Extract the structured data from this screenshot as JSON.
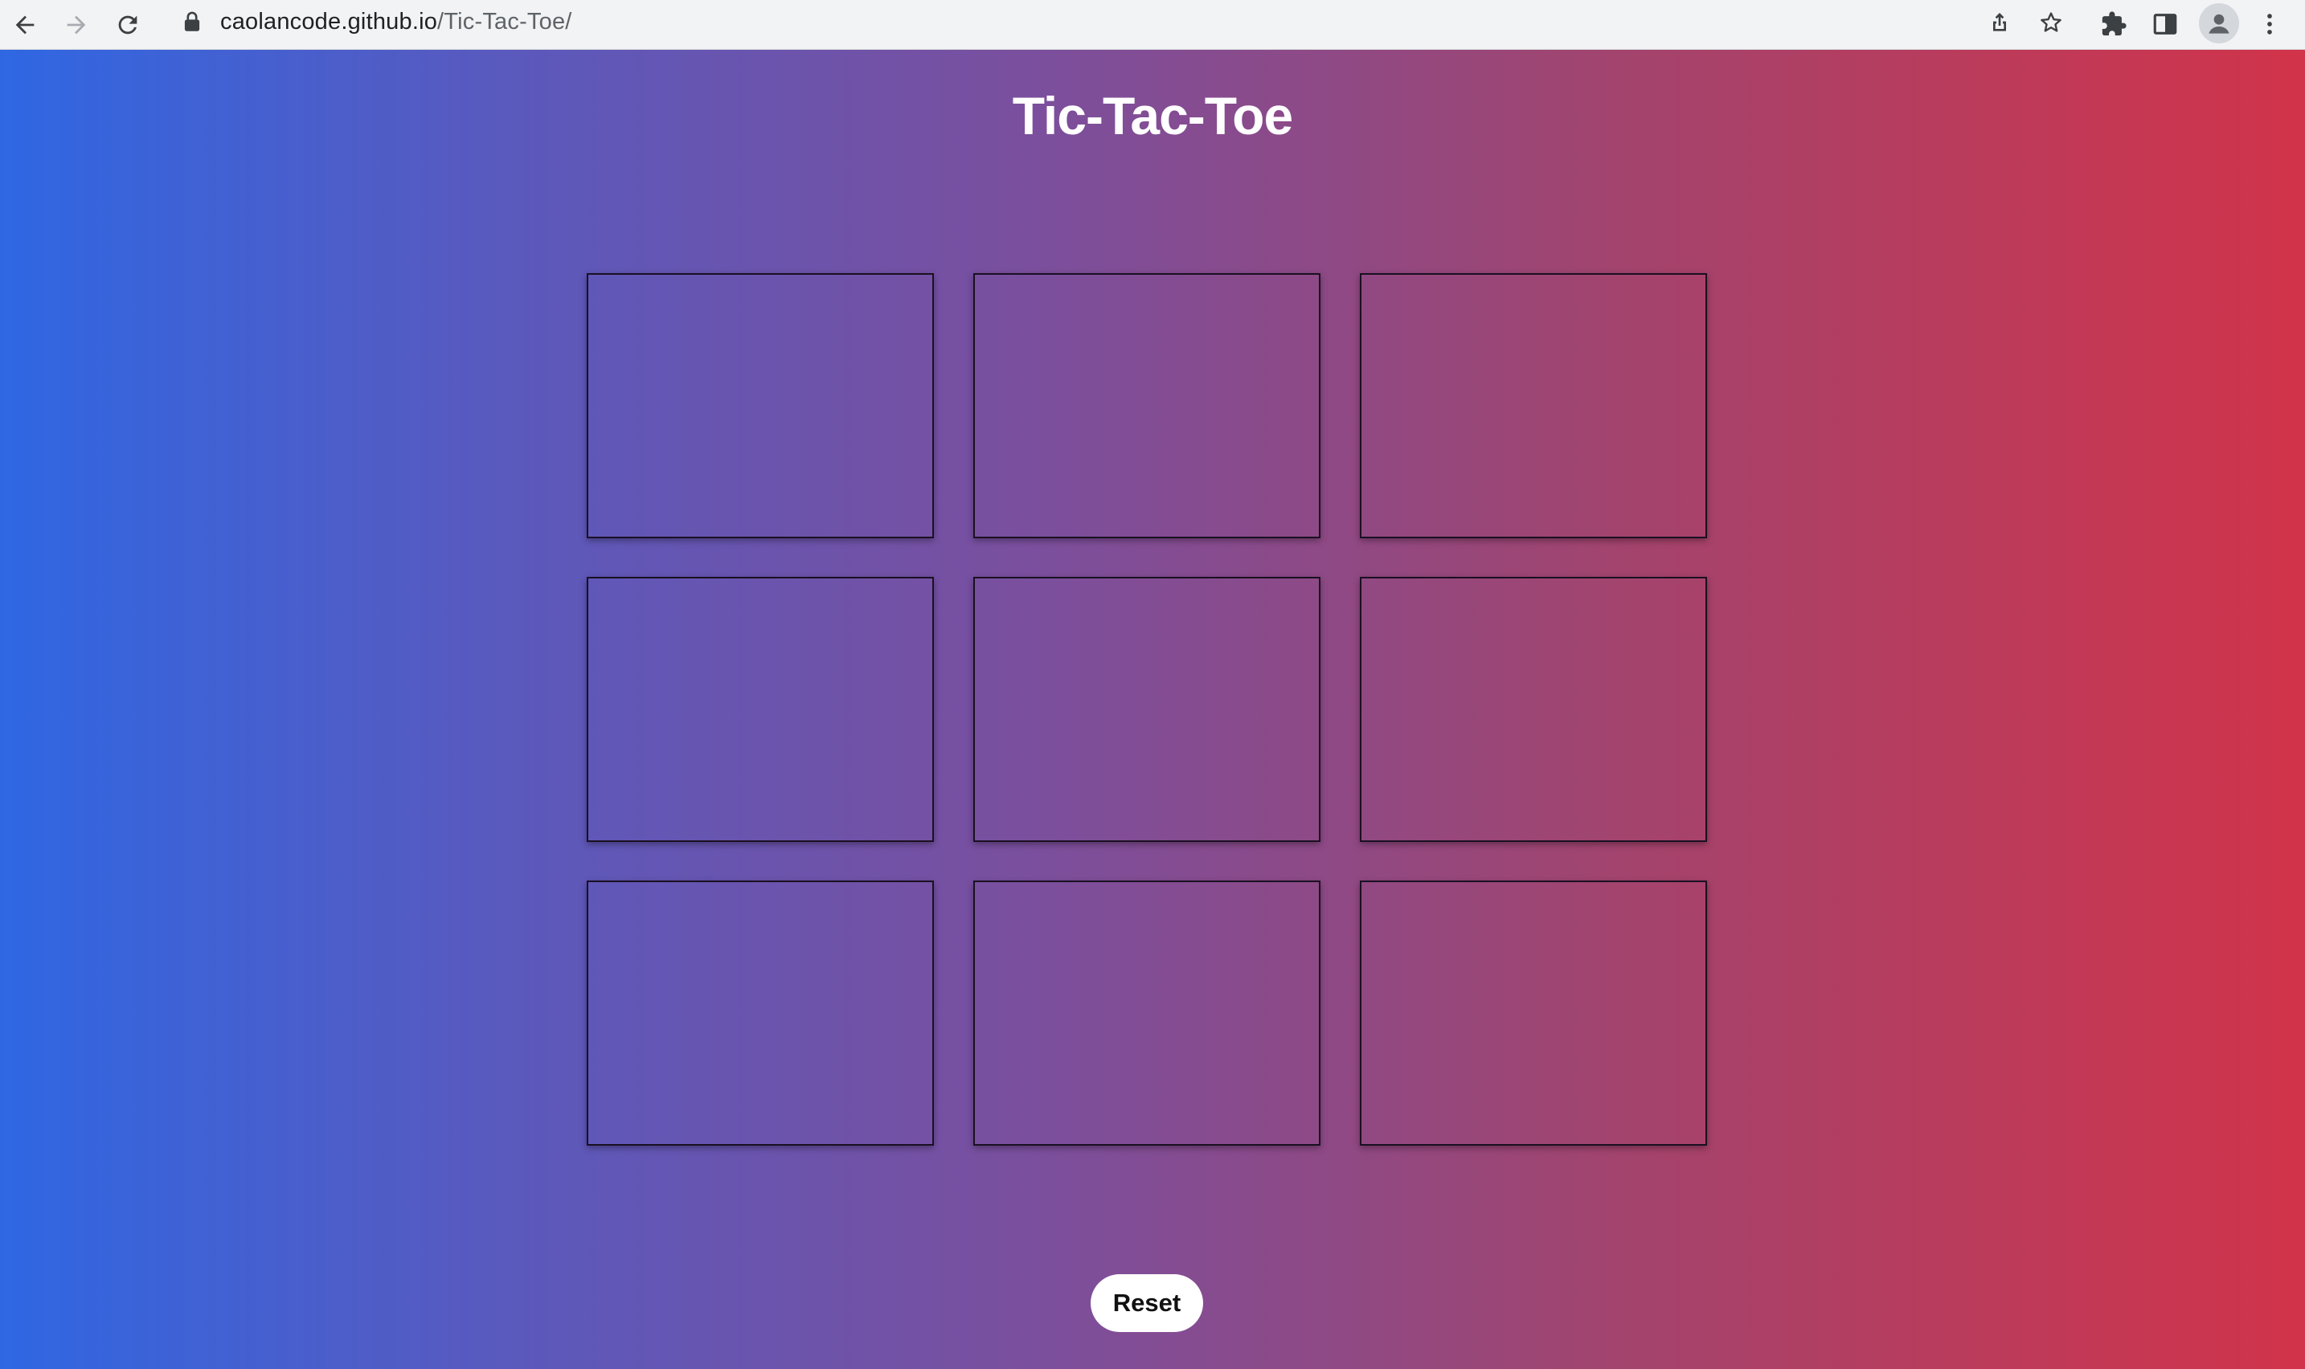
{
  "browser": {
    "url_host": "caolancode.github.io",
    "url_path": "/Tic-Tac-Toe/",
    "icons": [
      "back-icon",
      "forward-icon",
      "reload-icon",
      "lock-icon",
      "share-icon",
      "bookmark-star-icon",
      "extensions-icon",
      "side-panel-icon",
      "profile-icon",
      "menu-icon"
    ]
  },
  "page": {
    "title": "Tic-Tac-Toe",
    "board": {
      "cells": [
        "",
        "",
        "",
        "",
        "",
        "",
        "",
        "",
        ""
      ]
    },
    "reset_label": "Reset"
  },
  "colors": {
    "gradient_start": "#2f67e3",
    "gradient_end": "#d1334a",
    "title_text": "#ffffff",
    "cell_border": "#1a1022",
    "button_bg": "#ffffff"
  }
}
